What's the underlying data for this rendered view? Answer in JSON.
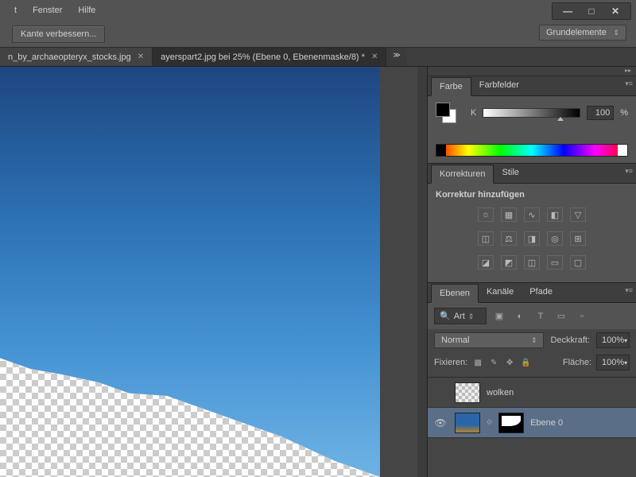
{
  "menu": {
    "items": [
      "t",
      "Fenster",
      "Hilfe"
    ]
  },
  "window": {
    "min": "—",
    "max": "□",
    "close": "✕"
  },
  "options": {
    "refine_edge": "Kante verbessern...",
    "workspace": "Grundelemente"
  },
  "tabs": {
    "t1": "n_by_archaeopteryx_stocks.jpg",
    "t2": "ayerspart2.jpg bei 25% (Ebene 0, Ebenenmaske/8) *",
    "more": "≫"
  },
  "panels": {
    "farbe": "Farbe",
    "farbfelder": "Farbfelder",
    "korrekturen": "Korrekturen",
    "stile": "Stile",
    "korrektur_hint": "Korrektur hinzufügen",
    "ebenen": "Ebenen",
    "kanale": "Kanäle",
    "pfade": "Pfade"
  },
  "color": {
    "k_label": "K",
    "k_value": "100",
    "pct": "%"
  },
  "layers": {
    "search_kind": "Art",
    "blend": "Normal",
    "opacity_label": "Deckkraft:",
    "opacity_value": "100%",
    "fill_label": "Fläche:",
    "fill_value": "100%",
    "lock_label": "Fixieren:",
    "items": [
      {
        "name": "wolken"
      },
      {
        "name": "Ebene 0"
      }
    ]
  }
}
